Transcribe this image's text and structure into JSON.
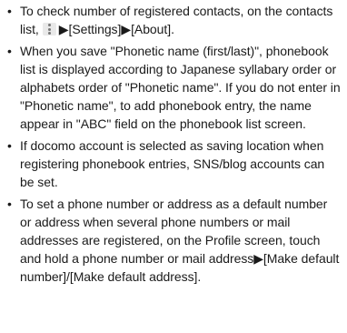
{
  "notes": [
    {
      "text_before_icon": "To check number of registered contacts, on the contacts list,",
      "icon": "menu-icon",
      "text_after_icon": "▶[Settings]▶[About]."
    },
    {
      "text": "When you save \"Phonetic name (first/last)\", phonebook list is displayed according to Japanese syllabary order or alphabets order of \"Phonetic name\". If you do not enter in \"Phonetic name\", to add phonebook entry, the name appear in \"ABC\" field on the phonebook list screen."
    },
    {
      "text": "If docomo account is selected as saving location when registering phonebook entries, SNS/blog accounts can be set."
    },
    {
      "text": "To set a phone number or address as a default number or address when several phone numbers or mail addresses are registered, on the Profile screen, touch and hold a phone number or mail address▶[Make default number]/[Make default address]."
    }
  ]
}
